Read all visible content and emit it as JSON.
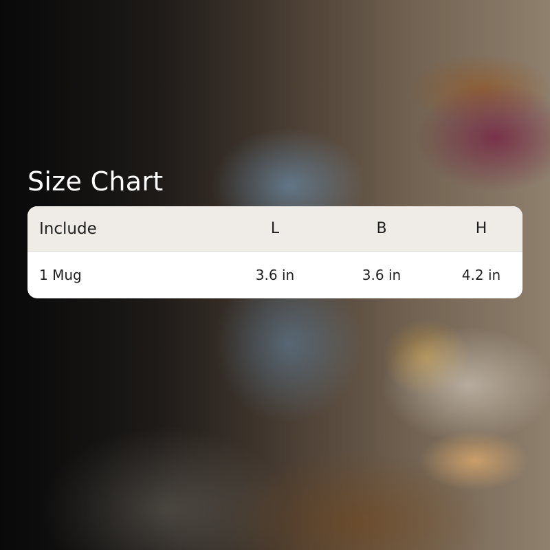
{
  "title": "Size Chart",
  "table": {
    "headers": [
      "Include",
      "L",
      "B",
      "H"
    ],
    "rows": [
      [
        "1 Mug",
        "3.6 in",
        "3.6 in",
        "4.2 in"
      ]
    ]
  },
  "colors": {
    "header_bg": "#efece8",
    "card_bg": "#ffffff",
    "text": "#1f1f1f",
    "title_text": "#ffffff"
  }
}
